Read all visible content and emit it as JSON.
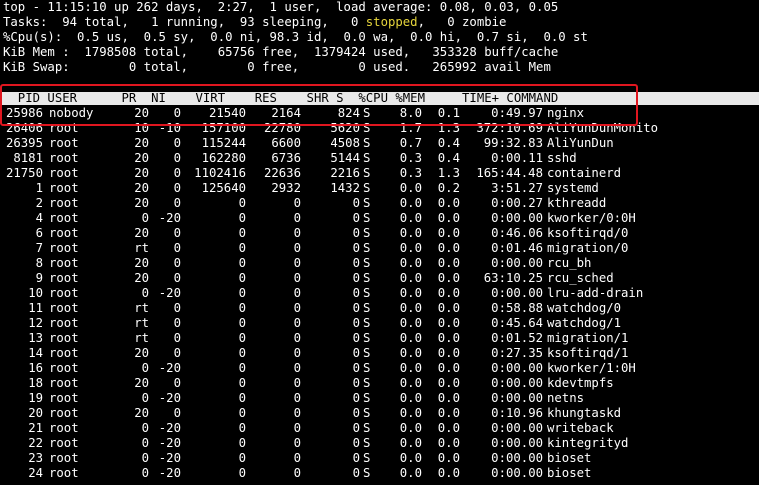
{
  "summary": {
    "line1": "top - 11:15:10 up 262 days,  2:27,  1 user,  load average: 0.08, 0.03, 0.05",
    "line2_pre": "Tasks:  94 total,   1 running,  93 sleeping,   0 ",
    "line2_stopped": "stopped",
    "line2_post": ",   0 zombie",
    "line3": "%Cpu(s):  0.5 us,  0.5 sy,  0.0 ni, 98.3 id,  0.0 wa,  0.0 hi,  0.7 si,  0.0 st",
    "line4": "KiB Mem :  1798508 total,    65756 free,  1379424 used,   353328 buff/cache",
    "line5": "KiB Swap:        0 total,        0 free,        0 used.   265992 avail Mem"
  },
  "columns": {
    "header": "  PID USER      PR  NI    VIRT    RES    SHR S  %CPU %MEM     TIME+ COMMAND"
  },
  "processes": [
    {
      "pid": "25986",
      "user": "nobody",
      "pr": "20",
      "ni": "0",
      "virt": "21540",
      "res": "2164",
      "shr": "824",
      "s": "S",
      "cpu": "8.0",
      "mem": "0.1",
      "time": "0:49.97",
      "cmd": "nginx"
    },
    {
      "pid": "26406",
      "user": "root",
      "pr": "10",
      "ni": "-10",
      "virt": "157100",
      "res": "22780",
      "shr": "5620",
      "s": "S",
      "cpu": "1.7",
      "mem": "1.3",
      "time": "372:10.69",
      "cmd": "AliYunDunMonito"
    },
    {
      "pid": "26395",
      "user": "root",
      "pr": "20",
      "ni": "0",
      "virt": "115244",
      "res": "6600",
      "shr": "4508",
      "s": "S",
      "cpu": "0.7",
      "mem": "0.4",
      "time": "99:32.83",
      "cmd": "AliYunDun"
    },
    {
      "pid": "8181",
      "user": "root",
      "pr": "20",
      "ni": "0",
      "virt": "162280",
      "res": "6736",
      "shr": "5144",
      "s": "S",
      "cpu": "0.3",
      "mem": "0.4",
      "time": "0:00.11",
      "cmd": "sshd"
    },
    {
      "pid": "21750",
      "user": "root",
      "pr": "20",
      "ni": "0",
      "virt": "1102416",
      "res": "22636",
      "shr": "2216",
      "s": "S",
      "cpu": "0.3",
      "mem": "1.3",
      "time": "165:44.48",
      "cmd": "containerd"
    },
    {
      "pid": "1",
      "user": "root",
      "pr": "20",
      "ni": "0",
      "virt": "125640",
      "res": "2932",
      "shr": "1432",
      "s": "S",
      "cpu": "0.0",
      "mem": "0.2",
      "time": "3:51.27",
      "cmd": "systemd"
    },
    {
      "pid": "2",
      "user": "root",
      "pr": "20",
      "ni": "0",
      "virt": "0",
      "res": "0",
      "shr": "0",
      "s": "S",
      "cpu": "0.0",
      "mem": "0.0",
      "time": "0:00.27",
      "cmd": "kthreadd"
    },
    {
      "pid": "4",
      "user": "root",
      "pr": "0",
      "ni": "-20",
      "virt": "0",
      "res": "0",
      "shr": "0",
      "s": "S",
      "cpu": "0.0",
      "mem": "0.0",
      "time": "0:00.00",
      "cmd": "kworker/0:0H"
    },
    {
      "pid": "6",
      "user": "root",
      "pr": "20",
      "ni": "0",
      "virt": "0",
      "res": "0",
      "shr": "0",
      "s": "S",
      "cpu": "0.0",
      "mem": "0.0",
      "time": "0:46.06",
      "cmd": "ksoftirqd/0"
    },
    {
      "pid": "7",
      "user": "root",
      "pr": "rt",
      "ni": "0",
      "virt": "0",
      "res": "0",
      "shr": "0",
      "s": "S",
      "cpu": "0.0",
      "mem": "0.0",
      "time": "0:01.46",
      "cmd": "migration/0"
    },
    {
      "pid": "8",
      "user": "root",
      "pr": "20",
      "ni": "0",
      "virt": "0",
      "res": "0",
      "shr": "0",
      "s": "S",
      "cpu": "0.0",
      "mem": "0.0",
      "time": "0:00.00",
      "cmd": "rcu_bh"
    },
    {
      "pid": "9",
      "user": "root",
      "pr": "20",
      "ni": "0",
      "virt": "0",
      "res": "0",
      "shr": "0",
      "s": "S",
      "cpu": "0.0",
      "mem": "0.0",
      "time": "63:10.25",
      "cmd": "rcu_sched"
    },
    {
      "pid": "10",
      "user": "root",
      "pr": "0",
      "ni": "-20",
      "virt": "0",
      "res": "0",
      "shr": "0",
      "s": "S",
      "cpu": "0.0",
      "mem": "0.0",
      "time": "0:00.00",
      "cmd": "lru-add-drain"
    },
    {
      "pid": "11",
      "user": "root",
      "pr": "rt",
      "ni": "0",
      "virt": "0",
      "res": "0",
      "shr": "0",
      "s": "S",
      "cpu": "0.0",
      "mem": "0.0",
      "time": "0:58.88",
      "cmd": "watchdog/0"
    },
    {
      "pid": "12",
      "user": "root",
      "pr": "rt",
      "ni": "0",
      "virt": "0",
      "res": "0",
      "shr": "0",
      "s": "S",
      "cpu": "0.0",
      "mem": "0.0",
      "time": "0:45.64",
      "cmd": "watchdog/1"
    },
    {
      "pid": "13",
      "user": "root",
      "pr": "rt",
      "ni": "0",
      "virt": "0",
      "res": "0",
      "shr": "0",
      "s": "S",
      "cpu": "0.0",
      "mem": "0.0",
      "time": "0:01.52",
      "cmd": "migration/1"
    },
    {
      "pid": "14",
      "user": "root",
      "pr": "20",
      "ni": "0",
      "virt": "0",
      "res": "0",
      "shr": "0",
      "s": "S",
      "cpu": "0.0",
      "mem": "0.0",
      "time": "0:27.35",
      "cmd": "ksoftirqd/1"
    },
    {
      "pid": "16",
      "user": "root",
      "pr": "0",
      "ni": "-20",
      "virt": "0",
      "res": "0",
      "shr": "0",
      "s": "S",
      "cpu": "0.0",
      "mem": "0.0",
      "time": "0:00.00",
      "cmd": "kworker/1:0H"
    },
    {
      "pid": "18",
      "user": "root",
      "pr": "20",
      "ni": "0",
      "virt": "0",
      "res": "0",
      "shr": "0",
      "s": "S",
      "cpu": "0.0",
      "mem": "0.0",
      "time": "0:00.00",
      "cmd": "kdevtmpfs"
    },
    {
      "pid": "19",
      "user": "root",
      "pr": "0",
      "ni": "-20",
      "virt": "0",
      "res": "0",
      "shr": "0",
      "s": "S",
      "cpu": "0.0",
      "mem": "0.0",
      "time": "0:00.00",
      "cmd": "netns"
    },
    {
      "pid": "20",
      "user": "root",
      "pr": "20",
      "ni": "0",
      "virt": "0",
      "res": "0",
      "shr": "0",
      "s": "S",
      "cpu": "0.0",
      "mem": "0.0",
      "time": "0:10.96",
      "cmd": "khungtaskd"
    },
    {
      "pid": "21",
      "user": "root",
      "pr": "0",
      "ni": "-20",
      "virt": "0",
      "res": "0",
      "shr": "0",
      "s": "S",
      "cpu": "0.0",
      "mem": "0.0",
      "time": "0:00.00",
      "cmd": "writeback"
    },
    {
      "pid": "22",
      "user": "root",
      "pr": "0",
      "ni": "-20",
      "virt": "0",
      "res": "0",
      "shr": "0",
      "s": "S",
      "cpu": "0.0",
      "mem": "0.0",
      "time": "0:00.00",
      "cmd": "kintegrityd"
    },
    {
      "pid": "23",
      "user": "root",
      "pr": "0",
      "ni": "-20",
      "virt": "0",
      "res": "0",
      "shr": "0",
      "s": "S",
      "cpu": "0.0",
      "mem": "0.0",
      "time": "0:00.00",
      "cmd": "bioset"
    },
    {
      "pid": "24",
      "user": "root",
      "pr": "0",
      "ni": "-20",
      "virt": "0",
      "res": "0",
      "shr": "0",
      "s": "S",
      "cpu": "0.0",
      "mem": "0.0",
      "time": "0:00.00",
      "cmd": "bioset"
    }
  ],
  "colors": {
    "background": "#000000",
    "text": "#ffffff",
    "stopped_highlight": "#e6d53b",
    "header_bar": "#e9e9e9",
    "annotation_box": "#e0161f"
  }
}
